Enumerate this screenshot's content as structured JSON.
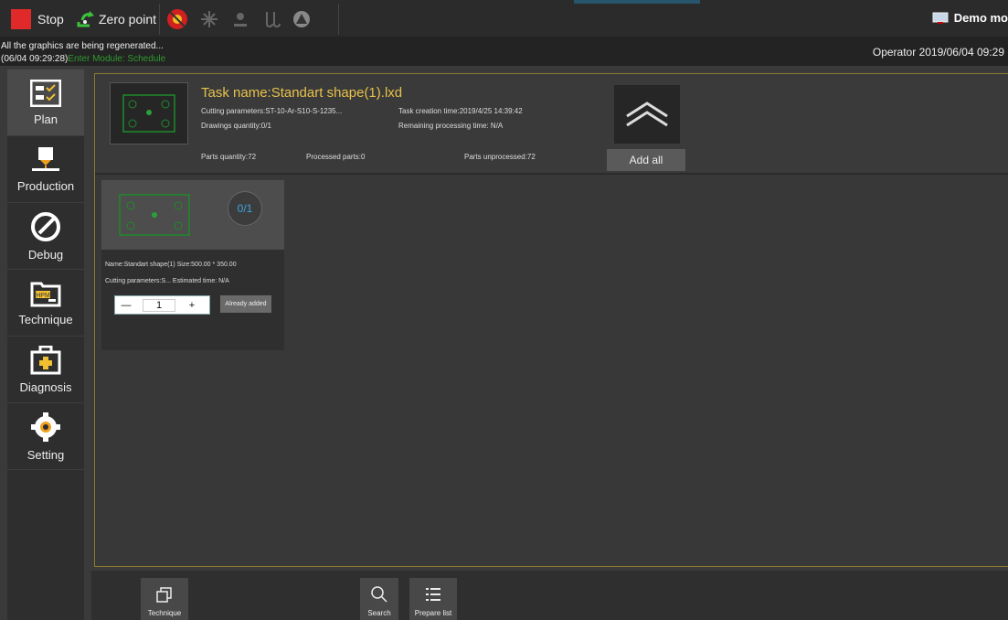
{
  "toolbar": {
    "stop_label": "Stop",
    "zero_point_label": "Zero point",
    "demo_label": "Demo mo"
  },
  "status": {
    "line1": "All the graphics are being regenerated...",
    "line2_time": "(06/04 09:29:28)",
    "line2_msg": "Enter Module: Schedule",
    "operator": "Operator  2019/06/04 09:29"
  },
  "sidebar": {
    "items": [
      {
        "label": "Plan",
        "icon": "plan-icon"
      },
      {
        "label": "Production",
        "icon": "production-icon"
      },
      {
        "label": "Debug",
        "icon": "debug-icon"
      },
      {
        "label": "Technique",
        "icon": "technique-icon"
      },
      {
        "label": "Diagnosis",
        "icon": "diagnosis-icon"
      },
      {
        "label": "Setting",
        "icon": "setting-icon"
      }
    ]
  },
  "task": {
    "name": "Task name:Standart shape(1).lxd",
    "cutting_params": "Cutting parameters:ST-10-Ar-S10-S-1235...",
    "drawings_qty": "Drawings quantity:0/1",
    "creation_time": "Task creation time:2019/4/25 14:39:42",
    "remaining_time": "Remaining processing time: N/A",
    "parts_qty": "Parts quantity:72",
    "processed": "Processed parts:0",
    "unprocessed": "Parts unprocessed:72",
    "add_all": "Add all"
  },
  "card": {
    "badge": "0/1",
    "name_size": "Name:Standart shape(1) Size:500.00 * 350.00",
    "params_time": "Cutting parameters:S...  Estimated time: N/A",
    "qty": "1",
    "minus": "—",
    "plus": "+",
    "already": "Already added"
  },
  "bottom": {
    "technique": "Technique",
    "search": "Search",
    "prepare": "Prepare list"
  },
  "colors": {
    "accent": "#e8c24a",
    "stop": "#e02a2a",
    "green": "#2e9a2e",
    "badge": "#3da5e0"
  }
}
